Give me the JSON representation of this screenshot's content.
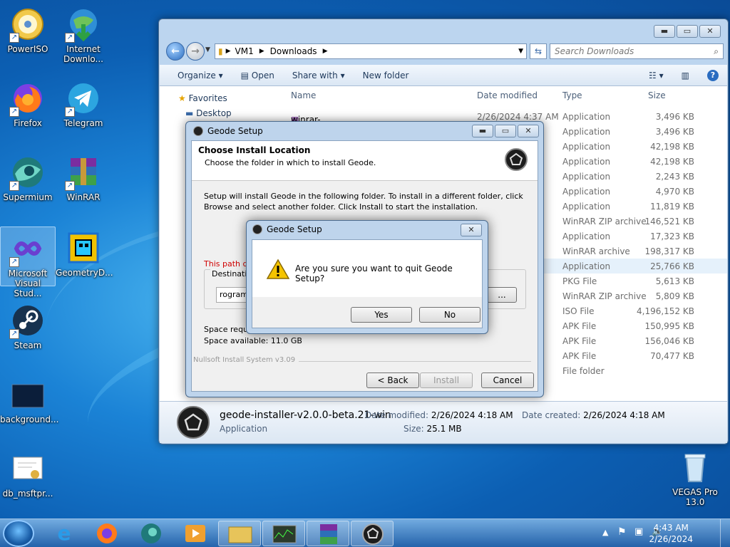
{
  "desktop": {
    "icons": [
      {
        "label": "PowerISO"
      },
      {
        "label": "Internet Downlo..."
      },
      {
        "label": "Firefox"
      },
      {
        "label": "Telegram"
      },
      {
        "label": "Supermium"
      },
      {
        "label": "WinRAR"
      },
      {
        "label": "Microsoft Visual Stud..."
      },
      {
        "label": "GeometryD..."
      },
      {
        "label": "Steam"
      },
      {
        "label": "background..."
      },
      {
        "label": "db_msftpr..."
      },
      {
        "label": "VEGAS Pro 13.0"
      }
    ]
  },
  "explorer": {
    "path": [
      "VM1",
      "Downloads"
    ],
    "search_placeholder": "Search Downloads",
    "toolbar": {
      "organize": "Organize",
      "open": "Open",
      "share_with": "Share with",
      "new_folder": "New folder"
    },
    "nav": {
      "favorites": "Favorites",
      "desktop": "Desktop"
    },
    "columns": {
      "name": "Name",
      "date": "Date modified",
      "type": "Type",
      "size": "Size"
    },
    "first_row": {
      "name": "winrar-x64-624",
      "date": "2/26/2024 4:37 AM"
    },
    "rows": [
      {
        "type": "Application",
        "size": "3,496 KB"
      },
      {
        "type": "Application",
        "size": "3,496 KB"
      },
      {
        "type": "Application",
        "size": "42,198 KB"
      },
      {
        "type": "Application",
        "size": "42,198 KB"
      },
      {
        "type": "Application",
        "size": "2,243 KB"
      },
      {
        "type": "Application",
        "size": "4,970 KB"
      },
      {
        "type": "Application",
        "size": "11,819 KB"
      },
      {
        "type": "WinRAR ZIP archive",
        "size": "146,521 KB"
      },
      {
        "type": "Application",
        "size": "17,323 KB"
      },
      {
        "type": "WinRAR archive",
        "size": "198,317 KB"
      },
      {
        "type": "Application",
        "size": "25,766 KB"
      },
      {
        "type": "PKG File",
        "size": "5,613 KB"
      },
      {
        "type": "WinRAR ZIP archive",
        "size": "5,809 KB"
      },
      {
        "type": "ISO File",
        "size": "4,196,152 KB"
      },
      {
        "type": "APK File",
        "size": "150,995 KB"
      },
      {
        "type": "APK File",
        "size": "156,046 KB"
      },
      {
        "type": "APK File",
        "size": "70,477 KB"
      },
      {
        "type": "File folder",
        "size": ""
      }
    ],
    "details": {
      "filename": "geode-installer-v2.0.0-beta.21-win",
      "filetype": "Application",
      "date_modified_label": "Date modified:",
      "date_modified": "2/26/2024 4:18 AM",
      "date_created_label": "Date created:",
      "date_created": "2/26/2024 4:18 AM",
      "size_label": "Size:",
      "size": "25.1 MB"
    }
  },
  "setup": {
    "title": "Geode Setup",
    "heading": "Choose Install Location",
    "subheading": "Choose the folder in which to install Geode.",
    "description": "Setup will install Geode in the following folder. To install in a different folder, click Browse and select another folder. Click Install to start the installation.",
    "warning": "This path do",
    "destination_label": "Destination",
    "destination_value": "rogram",
    "browse": "...",
    "space_required": "Space requir",
    "space_available": "Space available: 11.0 GB",
    "nullsoft": "Nullsoft Install System v3.09",
    "back": "< Back",
    "install": "Install",
    "cancel": "Cancel"
  },
  "confirm": {
    "title": "Geode Setup",
    "message": "Are you sure you want to quit Geode Setup?",
    "yes": "Yes",
    "no": "No"
  },
  "taskbar": {
    "time": "4:43 AM",
    "date": "2/26/2024"
  }
}
